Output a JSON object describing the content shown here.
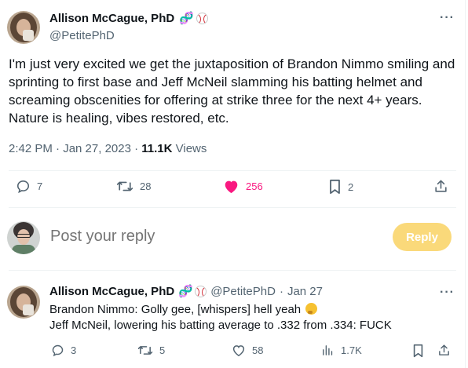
{
  "main_tweet": {
    "author": {
      "display_name": "Allison McCague, PhD",
      "handle": "@PetitePhD",
      "name_emojis": [
        "dna-icon",
        "baseball-icon"
      ]
    },
    "text": "I'm just very excited we get the juxtaposition of Brandon Nimmo smiling and sprinting to first base and Jeff McNeil slamming his batting helmet and screaming obscenities for offering at strike three for the next 4+ years. Nature is healing, vibes restored, etc.",
    "timestamp": "2:42 PM · Jan 27, 2023 · ",
    "views_count": "11.1K",
    "views_label": " Views",
    "actions": {
      "replies": "7",
      "retweets": "28",
      "likes": "256",
      "bookmarks": "2"
    },
    "like_color": "#f91880"
  },
  "composer": {
    "placeholder": "Post your reply",
    "button_label": "Reply",
    "button_color": "#fad97a"
  },
  "reply_tweet": {
    "author": {
      "display_name": "Allison McCague, PhD",
      "handle": "@PetitePhD",
      "separator": "·",
      "time": "Jan 27"
    },
    "line1": "Brandon Nimmo: Golly gee, [whispers] hell yeah",
    "line2": "Jeff McNeil, lowering his batting average to .332 from .334: FUCK",
    "actions": {
      "replies": "3",
      "retweets": "5",
      "likes": "58",
      "views": "1.7K"
    }
  },
  "colors": {
    "text_primary": "#0f1419",
    "text_secondary": "#536471",
    "divider": "#eff3f4"
  }
}
